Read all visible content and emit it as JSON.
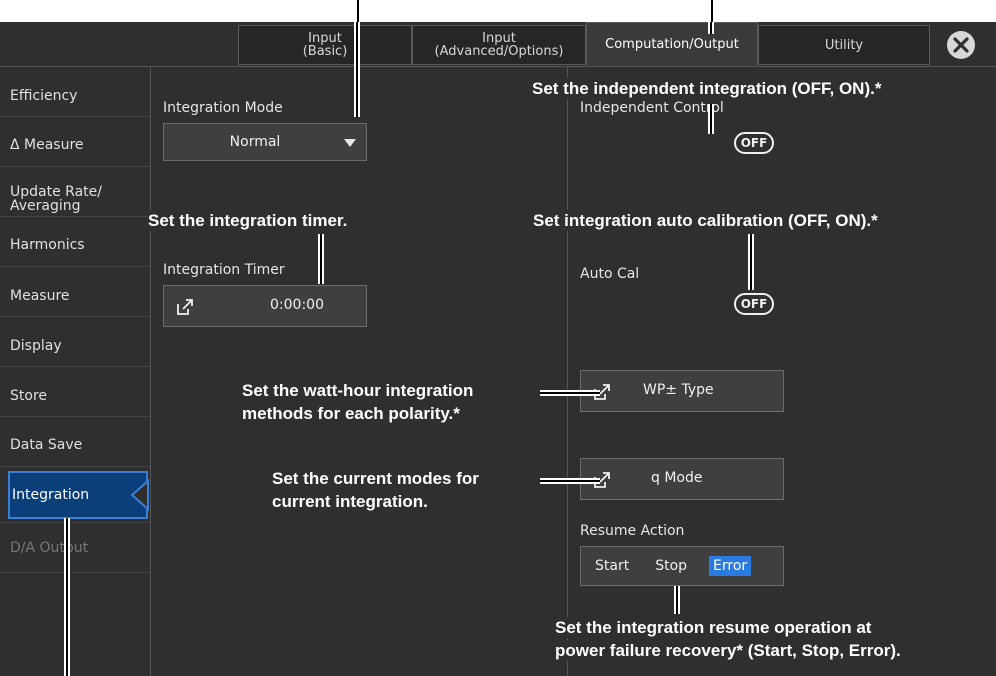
{
  "tabs": [
    {
      "label": "Input\n(Basic)"
    },
    {
      "label": "Input\n(Advanced/Options)"
    },
    {
      "label": "Computation/Output"
    },
    {
      "label": "Utility"
    }
  ],
  "sidebar": {
    "items": [
      {
        "label": "Efficiency"
      },
      {
        "label": "Δ Measure"
      },
      {
        "label": "Update Rate/\nAveraging"
      },
      {
        "label": "Harmonics"
      },
      {
        "label": "Measure"
      },
      {
        "label": "Display"
      },
      {
        "label": "Store"
      },
      {
        "label": "Data Save"
      },
      {
        "label": "Integration"
      },
      {
        "label": "D/A Output"
      }
    ]
  },
  "main": {
    "integration_mode_label": "Integration Mode",
    "integration_mode_value": "Normal",
    "integration_timer_label": "Integration Timer",
    "integration_timer_value": "0:00:00",
    "independent_control_label": "Independent Control",
    "independent_control_value": "OFF",
    "auto_cal_label": "Auto Cal",
    "auto_cal_value": "OFF",
    "wp_type_label": "WP± Type",
    "q_mode_label": "q Mode",
    "resume_action_label": "Resume Action",
    "resume_options": [
      "Start",
      "Stop",
      "Error"
    ]
  },
  "annotations": {
    "independent": "Set the independent integration (OFF, ON).*",
    "timer": "Set the integration timer.",
    "autocal": "Set integration auto calibration (OFF, ON).*",
    "wp_line1": "Set the watt-hour integration",
    "wp_line2": "methods for each polarity.*",
    "q_line1": "Set the current modes for",
    "q_line2": "current integration.",
    "resume_line1": "Set the integration resume operation at",
    "resume_line2": "power failure recovery* (Start, Stop, Error)."
  },
  "colors": {
    "background": "#2f2f2f",
    "accent": "#2a7be0",
    "active_item": "#0a3f7a"
  }
}
